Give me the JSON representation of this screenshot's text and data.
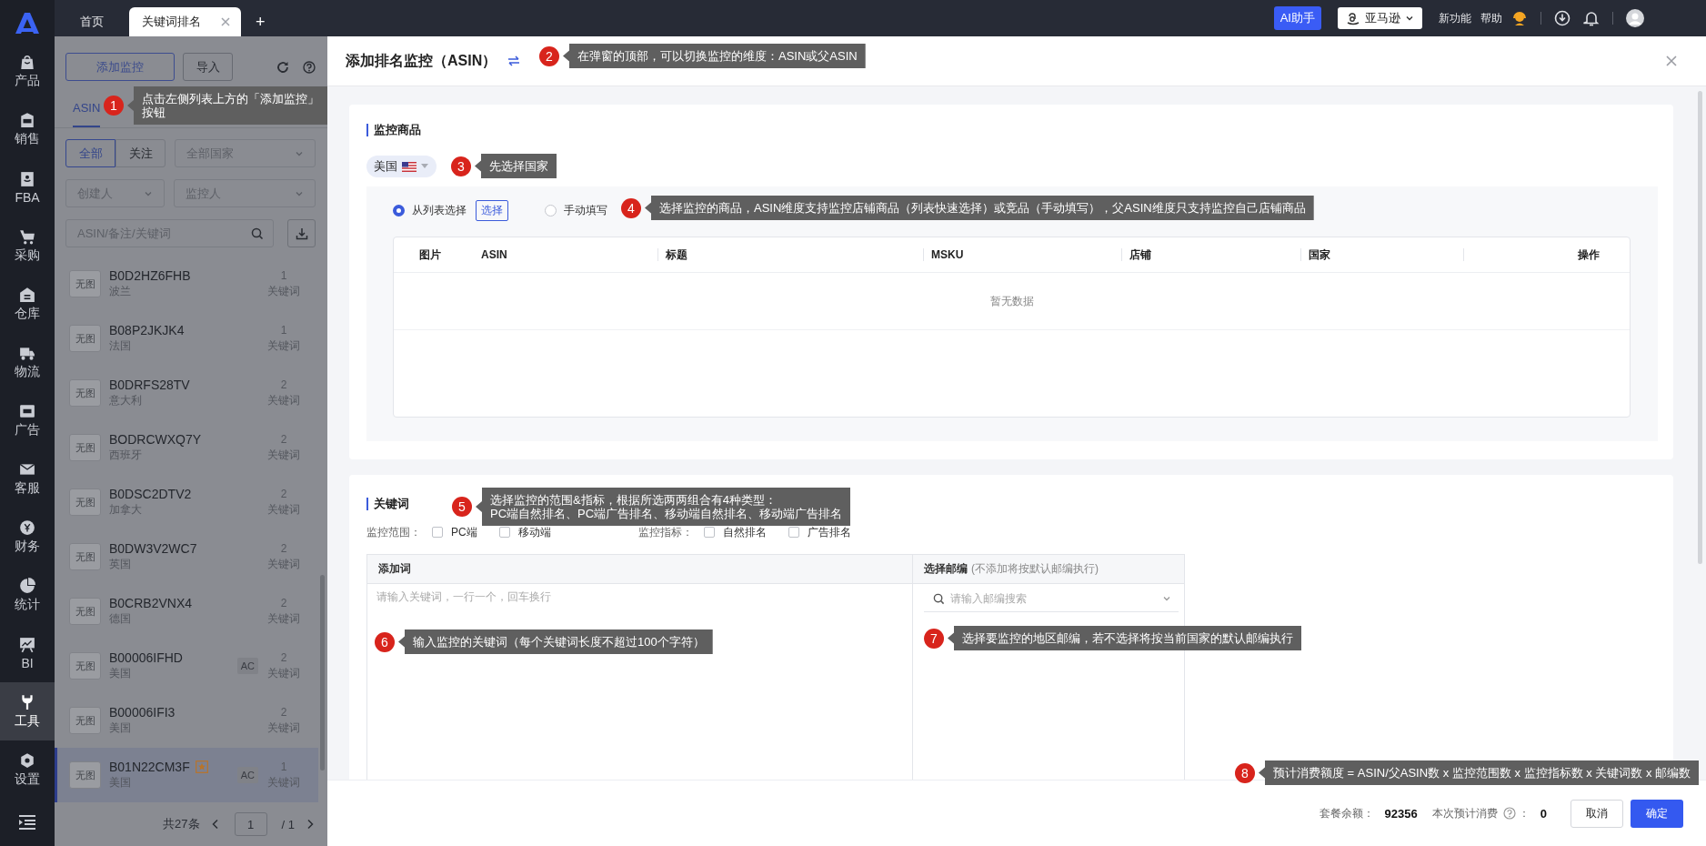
{
  "top_bar": {
    "tabs": [
      {
        "label": "首页",
        "selected": false,
        "closable": false
      },
      {
        "label": "关键词排名",
        "selected": true,
        "closable": true
      }
    ],
    "new_tab": "+",
    "ai_button": "AI助手",
    "platform": "亚马逊",
    "links": [
      "新功能",
      "帮助"
    ]
  },
  "nav": {
    "items": [
      {
        "label": "产品",
        "selected": false
      },
      {
        "label": "销售",
        "selected": false
      },
      {
        "label": "FBA",
        "selected": false
      },
      {
        "label": "采购",
        "selected": false
      },
      {
        "label": "仓库",
        "selected": false
      },
      {
        "label": "物流",
        "selected": false
      },
      {
        "label": "广告",
        "selected": false
      },
      {
        "label": "客服",
        "selected": false
      },
      {
        "label": "财务",
        "selected": false
      },
      {
        "label": "统计",
        "selected": false
      },
      {
        "label": "BI",
        "selected": false
      },
      {
        "label": "工具",
        "selected": true
      },
      {
        "label": "设置",
        "selected": false
      }
    ]
  },
  "monitor_list": {
    "add_button": "添加监控",
    "import_button": "导入",
    "tabs": [
      {
        "label": "ASIN",
        "selected": true
      }
    ],
    "segments": [
      {
        "label": "全部",
        "selected": true
      },
      {
        "label": "关注",
        "selected": false
      }
    ],
    "country_filter": {
      "placeholder": "全部国家"
    },
    "creator_filter": {
      "placeholder": "创建人"
    },
    "monitor_filter": {
      "placeholder": "监控人"
    },
    "search": {
      "placeholder": "ASIN/备注/关键词"
    },
    "items": [
      {
        "thumb": "无图",
        "asin": "B0D2HZ6FHB",
        "country": "波兰",
        "count": "1",
        "count_label": "关键词",
        "starred": false,
        "selected": false
      },
      {
        "thumb": "无图",
        "asin": "B08P2JKJK4",
        "country": "法国",
        "count": "1",
        "count_label": "关键词",
        "starred": false,
        "selected": false
      },
      {
        "thumb": "无图",
        "asin": "B0DRFS28TV",
        "country": "意大利",
        "count": "2",
        "count_label": "关键词",
        "starred": false,
        "selected": false
      },
      {
        "thumb": "无图",
        "asin": "BODRCWXQ7Y",
        "country": "西班牙",
        "count": "2",
        "count_label": "关键词",
        "starred": false,
        "selected": false
      },
      {
        "thumb": "无图",
        "asin": "B0DSC2DTV2",
        "country": "加拿大",
        "count": "2",
        "count_label": "关键词",
        "starred": false,
        "selected": false
      },
      {
        "thumb": "无图",
        "asin": "B0DW3V2WC7",
        "country": "英国",
        "count": "2",
        "count_label": "关键词",
        "starred": false,
        "selected": false
      },
      {
        "thumb": "无图",
        "asin": "B0CRB2VNX4",
        "country": "德国",
        "count": "2",
        "count_label": "关键词",
        "starred": false,
        "selected": false
      },
      {
        "thumb": "无图",
        "asin": "B00006IFHD",
        "country": "美国",
        "badge": "AC",
        "count": "2",
        "count_label": "关键词",
        "starred": false,
        "selected": false
      },
      {
        "thumb": "无图",
        "asin": "B00006IFI3",
        "country": "美国",
        "count": "2",
        "count_label": "关键词",
        "starred": false,
        "selected": false
      },
      {
        "thumb": "无图",
        "asin": "B01N22CM3F",
        "country": "美国",
        "badge": "AC",
        "count": "1",
        "count_label": "关键词",
        "starred": true,
        "selected": true
      }
    ],
    "pagination": {
      "total": "共27条",
      "page": "1",
      "pages": "/ 1"
    }
  },
  "dialog": {
    "title": "添加排名监控（ASIN）",
    "products": {
      "title": "监控商品",
      "country": "美国",
      "modes": [
        {
          "label": "从列表选择",
          "selected": true
        },
        {
          "label": "手动填写",
          "selected": false
        }
      ],
      "select_button": "选择",
      "table": {
        "columns": [
          "图片",
          "ASIN",
          "标题",
          "MSKU",
          "店铺",
          "国家",
          "操作"
        ],
        "empty_text": "暂无数据"
      }
    },
    "keywords": {
      "title": "关键词",
      "groups": [
        {
          "label": "监控范围：",
          "options": [
            {
              "label": "PC端",
              "checked": false
            },
            {
              "label": "移动端",
              "checked": false
            }
          ]
        },
        {
          "label": "监控指标：",
          "options": [
            {
              "label": "自然排名",
              "checked": false
            },
            {
              "label": "广告排名",
              "checked": false
            }
          ]
        }
      ],
      "keyword_input": {
        "header": "添加词",
        "placeholder": "请输入关键词，一行一个，回车换行"
      },
      "zip": {
        "header": "选择邮编",
        "hint": "(不添加将按默认邮编执行)",
        "placeholder": "请输入邮编搜索"
      }
    },
    "footer": {
      "balance_label": "套餐余额：",
      "balance": "92356",
      "estimate_label": "本次预计消费",
      "estimate_sep": "：",
      "estimate": "0",
      "cancel": "取消",
      "confirm": "确定"
    }
  },
  "annotations": [
    {
      "number": "1",
      "lines": [
        "点击左侧列表上方的「添加监控」",
        "按钮"
      ]
    },
    {
      "number": "2",
      "lines": [
        "在弹窗的顶部，可以切换监控的维度：ASIN或父ASIN"
      ]
    },
    {
      "number": "3",
      "lines": [
        "先选择国家"
      ]
    },
    {
      "number": "4",
      "lines": [
        "选择监控的商品，ASIN维度支持监控店铺商品（列表快速选择）或竞品（手动填写），父ASIN维度只支持监控自己店铺商品"
      ]
    },
    {
      "number": "5",
      "lines": [
        "选择监控的范围&指标，根据所选两两组合有4种类型：",
        "PC端自然排名、PC端广告排名、移动端自然排名、移动端广告排名"
      ]
    },
    {
      "number": "6",
      "lines": [
        "输入监控的关键词（每个关键词长度不超过100个字符）"
      ]
    },
    {
      "number": "7",
      "lines": [
        "选择要监控的地区邮编，若不选择将按当前国家的默认邮编执行"
      ]
    },
    {
      "number": "8",
      "lines": [
        "预计消费额度 = ASIN/父ASIN数 x 监控范围数 x 监控指标数 x 关键词数 x 邮编数"
      ]
    }
  ]
}
